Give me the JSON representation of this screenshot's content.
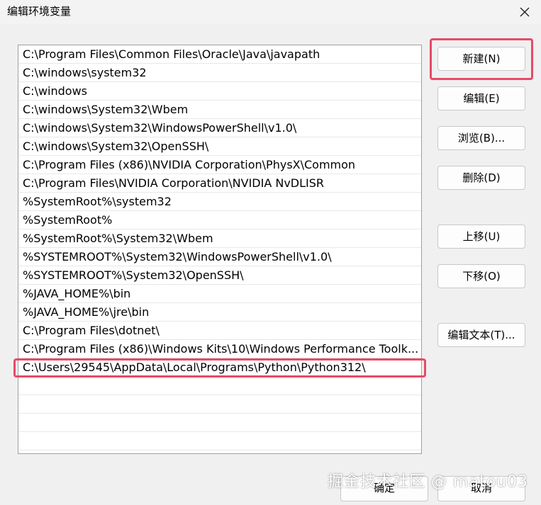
{
  "window": {
    "title": "编辑环境变量",
    "close_icon": "close-icon"
  },
  "list": {
    "items": [
      "C:\\Program Files\\Common Files\\Oracle\\Java\\javapath",
      "C:\\windows\\system32",
      "C:\\windows",
      "C:\\windows\\System32\\Wbem",
      "C:\\windows\\System32\\WindowsPowerShell\\v1.0\\",
      "C:\\windows\\System32\\OpenSSH\\",
      "C:\\Program Files (x86)\\NVIDIA Corporation\\PhysX\\Common",
      "C:\\Program Files\\NVIDIA Corporation\\NVIDIA NvDLISR",
      "%SystemRoot%\\system32",
      "%SystemRoot%",
      "%SystemRoot%\\System32\\Wbem",
      "%SYSTEMROOT%\\System32\\WindowsPowerShell\\v1.0\\",
      "%SYSTEMROOT%\\System32\\OpenSSH\\",
      "%JAVA_HOME%\\bin",
      "%JAVA_HOME%\\jre\\bin",
      "C:\\Program Files\\dotnet\\",
      "C:\\Program Files (x86)\\Windows Kits\\10\\Windows Performance Toolk...",
      "C:\\Users\\29545\\AppData\\Local\\Programs\\Python\\Python312\\",
      "",
      "",
      "",
      ""
    ]
  },
  "buttons": {
    "new": "新建(N)",
    "edit": "编辑(E)",
    "browse": "浏览(B)...",
    "delete": "删除(D)",
    "move_up": "上移(U)",
    "move_down": "下移(O)",
    "edit_text": "编辑文本(T)...",
    "ok": "确定",
    "cancel": "取消"
  },
  "watermark": "掘金技术社区 @ matou03",
  "colors": {
    "highlight": "#e84a68",
    "background": "#f0f0f0"
  }
}
